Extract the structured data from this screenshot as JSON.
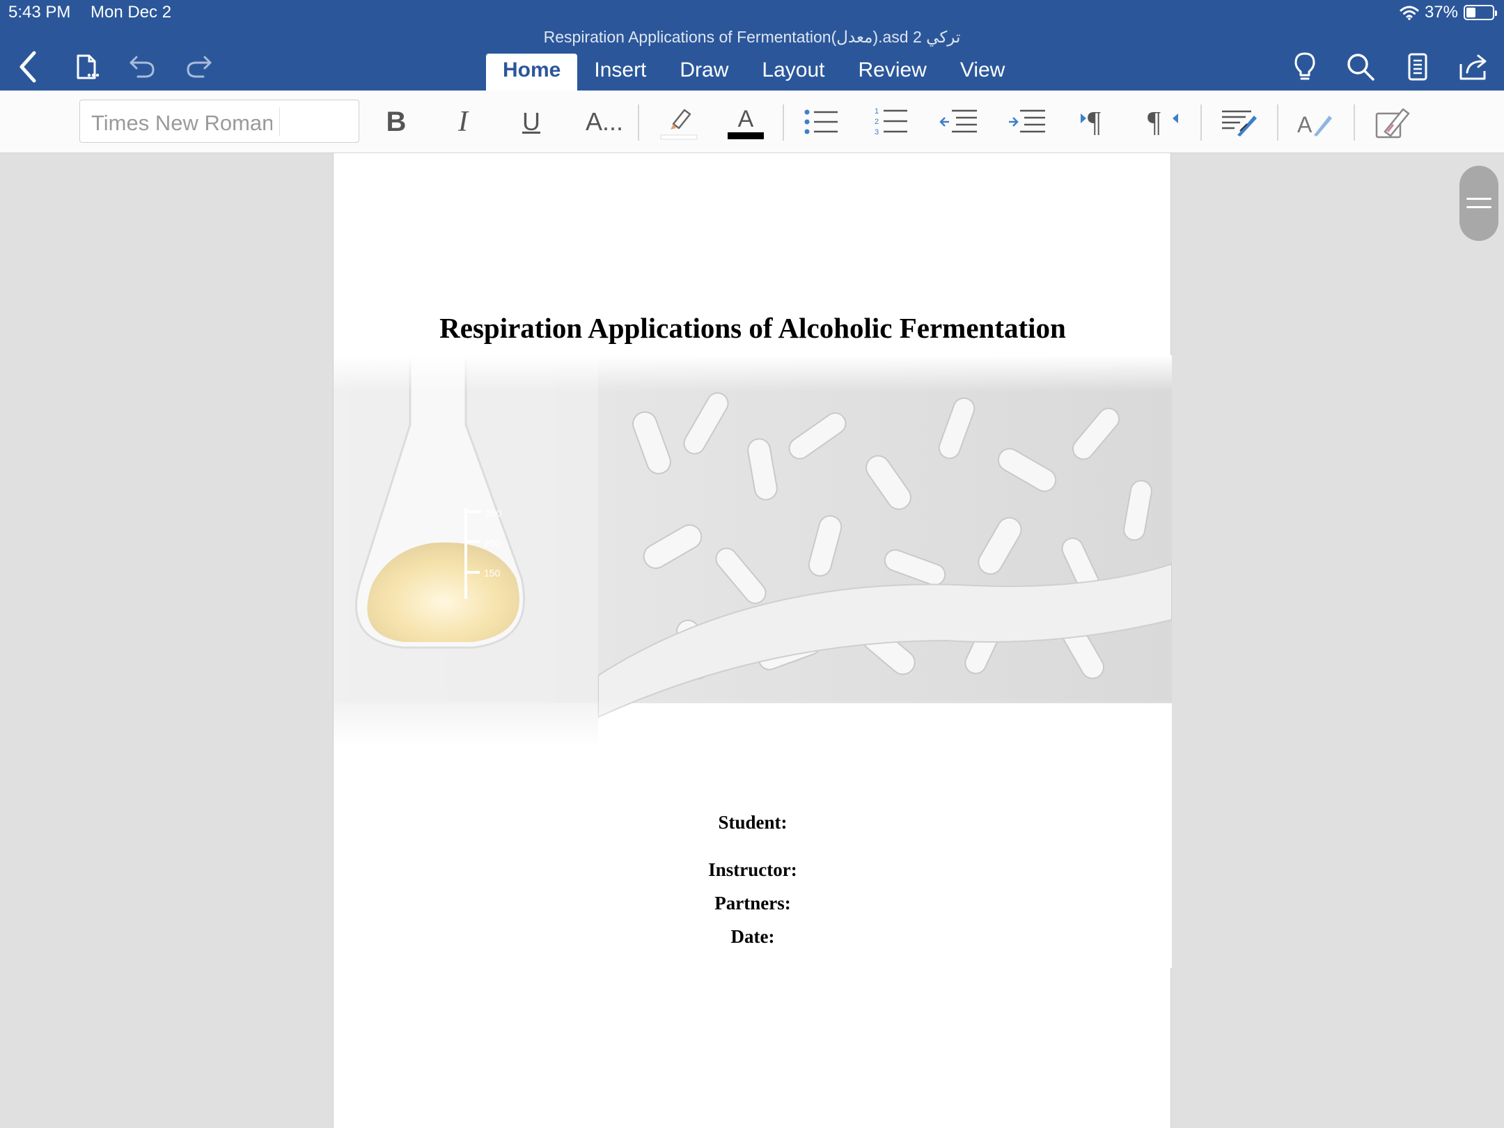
{
  "status": {
    "time": "5:43 PM",
    "date": "Mon Dec 2",
    "battery": "37%"
  },
  "document": {
    "title": "Respiration Applications of Fermentation(معدل).asd 2 تركي"
  },
  "tabs": [
    {
      "label": "Home",
      "active": true
    },
    {
      "label": "Insert"
    },
    {
      "label": "Draw"
    },
    {
      "label": "Layout"
    },
    {
      "label": "Review"
    },
    {
      "label": "View"
    }
  ],
  "ribbon": {
    "font_name": "Times New Roman",
    "more_label": "A..."
  },
  "colors": {
    "brand": "#2b579a",
    "font_color": "#000000",
    "accent_blue": "#3d7fc9"
  },
  "page": {
    "heading": "Respiration Applications of Alcoholic Fermentation",
    "fields": {
      "student": "Student:",
      "instructor": "Instructor:",
      "partners": "Partners:",
      "date": "Date:"
    },
    "cover_labels": [
      "250",
      "200",
      "150"
    ]
  }
}
